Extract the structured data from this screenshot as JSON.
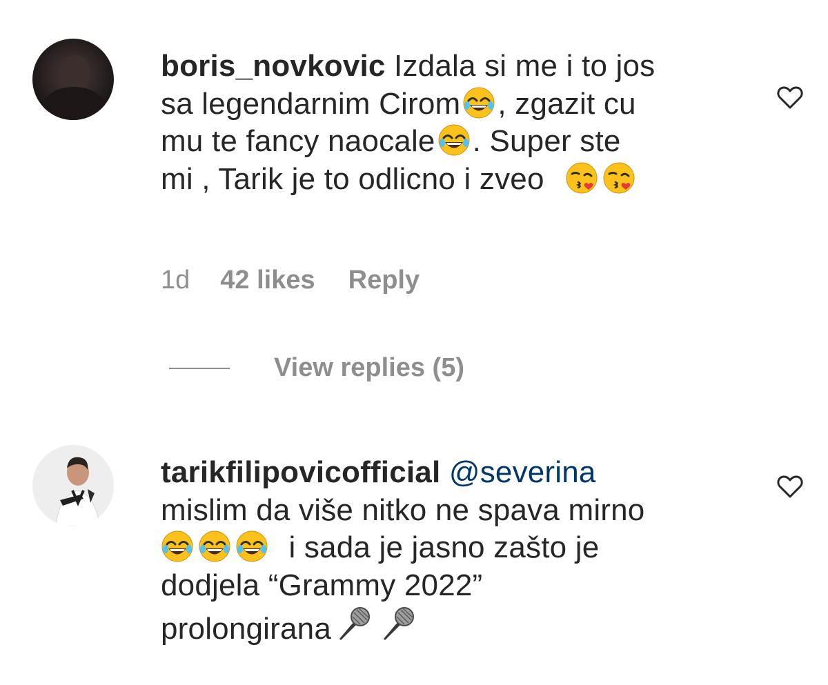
{
  "comments": [
    {
      "username": "boris_novkovic",
      "text_parts": [
        "Izdala si me i to jos",
        "sa legendarnim Cirom",
        ", zgazit cu",
        "mu te fancy naocale",
        ". Super ste",
        "mi , Tarik je to odlicno i zveo"
      ],
      "time": "1d",
      "likes": "42 likes",
      "reply_label": "Reply",
      "view_replies": "View replies (5)",
      "avatar_icon": "profile-avatar-dark",
      "like_icon": "heart-outline-icon"
    },
    {
      "username": "tarikfilipovicofficial",
      "mention": "@severina",
      "text_parts": [
        "mislim da više nitko ne spava mirno",
        "i sada je jasno zašto je",
        "dodjela “Grammy 2022”",
        "prolongirana"
      ],
      "avatar_icon": "profile-avatar-man",
      "like_icon": "heart-outline-icon"
    }
  ],
  "emoji": {
    "laugh": "face-with-tears-of-joy",
    "kiss": "face-blowing-kiss",
    "mic": "microphone"
  },
  "colors": {
    "text": "#262626",
    "muted": "#8e8e8e",
    "mention": "#00376b",
    "emoji_face": "#fcc21b"
  }
}
